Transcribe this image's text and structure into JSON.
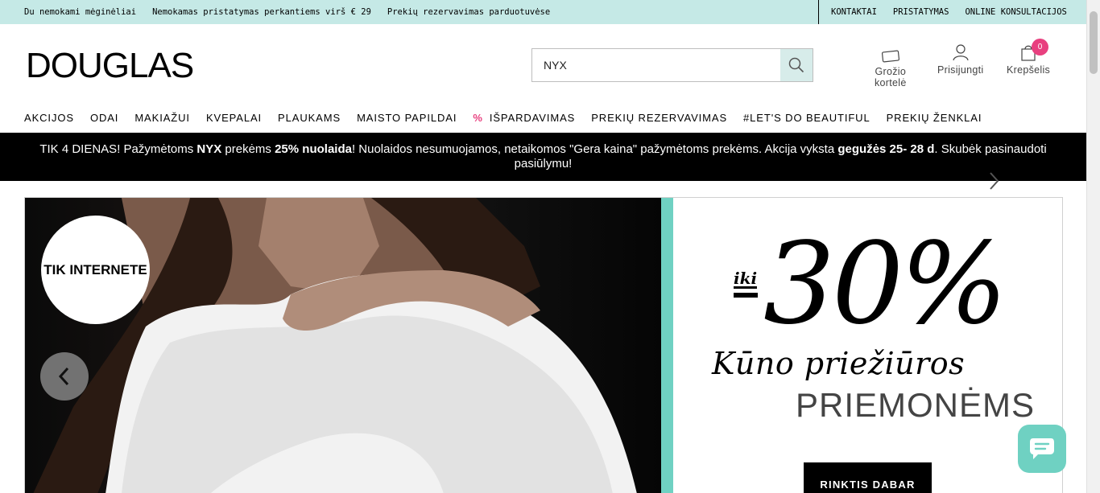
{
  "topbar": {
    "left": [
      "Du nemokami mėginėliai",
      "Nemokamas pristatymas perkantiems virš € 29",
      "Prekių rezervavimas parduotuvėse"
    ],
    "right": [
      "KONTAKTAI",
      "PRISTATYMAS",
      "ONLINE KONSULTACIJOS"
    ]
  },
  "header": {
    "logo": "DOUGLAS",
    "search": {
      "value": "NYX",
      "placeholder": ""
    },
    "beauty_card": {
      "line1": "Grožio",
      "line2": "kortelė"
    },
    "login": "Prisijungti",
    "cart": {
      "label": "Krepšelis",
      "count": "0"
    }
  },
  "nav": {
    "items": [
      "AKCIJOS",
      "ODAI",
      "MAKIAŽUI",
      "KVEPALAI",
      "PLAUKAMS",
      "MAISTO PAPILDAI",
      "IŠPARDAVIMAS",
      "PREKIŲ REZERVAVIMAS",
      "#LET'S DO BEAUTIFUL",
      "PREKIŲ ŽENKLAI"
    ],
    "sale_marker": "%"
  },
  "promo": {
    "t1": "TIK 4 DIENAS! Pažymėtoms ",
    "b1": "NYX",
    "t2": " prekėms ",
    "b2": "25% nuolaida",
    "t3": "! Nuolaidos nesumuojamos, netaikomos \"Gera kaina\" pažymėtoms prekėms. Akcija vyksta ",
    "b3": "gegužės 25- 28 d",
    "t4": ". Skubėk pasinaudoti pasiūlymu!"
  },
  "banner": {
    "badge": "TIK INTERNETE",
    "iki": "iki",
    "percent": "30%",
    "line1": "Kūno priežiūros",
    "line2": "PRIEMONĖMS",
    "cta": "RINKTIS DABAR"
  },
  "colors": {
    "accent": "#6fd1c2",
    "topbar": "#c5e9e6",
    "badge": "#e8407f"
  }
}
